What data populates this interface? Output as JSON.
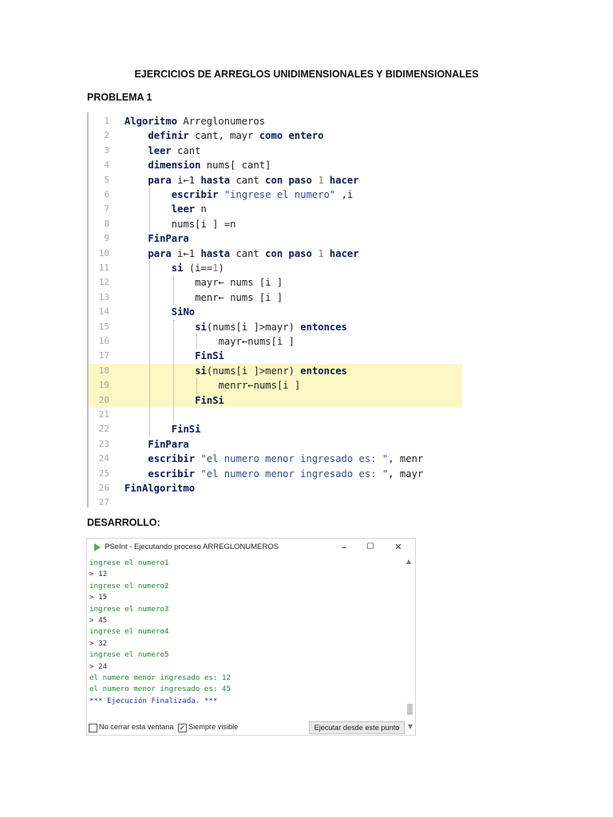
{
  "document": {
    "title": "EJERCICIOS DE ARREGLOS UNIDIMENSIONALES Y BIDIMENSIONALES",
    "problem_heading": "PROBLEMA 1",
    "development_heading": "DESARROLLO:"
  },
  "code": {
    "lines": [
      {
        "n": "1",
        "indent": 0,
        "tokens": [
          {
            "t": "Algoritmo",
            "c": "kw"
          },
          {
            "t": " Arreglonumeros"
          }
        ]
      },
      {
        "n": "2",
        "indent": 1,
        "tokens": [
          {
            "t": "definir",
            "c": "kw"
          },
          {
            "t": " cant, mayr "
          },
          {
            "t": "como",
            "c": "kw"
          },
          {
            "t": " "
          },
          {
            "t": "entero",
            "c": "kw"
          }
        ]
      },
      {
        "n": "3",
        "indent": 1,
        "tokens": [
          {
            "t": "leer",
            "c": "kw"
          },
          {
            "t": " cant"
          }
        ]
      },
      {
        "n": "4",
        "indent": 1,
        "tokens": [
          {
            "t": "dimension",
            "c": "kw"
          },
          {
            "t": " nums[ cant]"
          }
        ]
      },
      {
        "n": "5",
        "indent": 1,
        "tokens": [
          {
            "t": "para",
            "c": "kw"
          },
          {
            "t": " i←1 "
          },
          {
            "t": "hasta",
            "c": "kw"
          },
          {
            "t": " cant "
          },
          {
            "t": "con paso",
            "c": "kw"
          },
          {
            "t": " "
          },
          {
            "t": "1",
            "c": "num"
          },
          {
            "t": " "
          },
          {
            "t": "hacer",
            "c": "kw"
          }
        ]
      },
      {
        "n": "6",
        "indent": 2,
        "tokens": [
          {
            "t": "escribir",
            "c": "kw"
          },
          {
            "t": " "
          },
          {
            "t": "\"ingrese el numero\"",
            "c": "str"
          },
          {
            "t": " ,i"
          }
        ]
      },
      {
        "n": "7",
        "indent": 2,
        "tokens": [
          {
            "t": "leer",
            "c": "kw"
          },
          {
            "t": " n"
          }
        ]
      },
      {
        "n": "8",
        "indent": 2,
        "tokens": [
          {
            "t": "nums[i ] =n"
          }
        ]
      },
      {
        "n": "9",
        "indent": 1,
        "tokens": [
          {
            "t": "FinPara",
            "c": "kw"
          }
        ]
      },
      {
        "n": "10",
        "indent": 1,
        "tokens": [
          {
            "t": "para",
            "c": "kw"
          },
          {
            "t": " i←1 "
          },
          {
            "t": "hasta",
            "c": "kw"
          },
          {
            "t": " cant "
          },
          {
            "t": "con paso",
            "c": "kw"
          },
          {
            "t": " "
          },
          {
            "t": "1",
            "c": "num"
          },
          {
            "t": " "
          },
          {
            "t": "hacer",
            "c": "kw"
          }
        ]
      },
      {
        "n": "11",
        "indent": 2,
        "tokens": [
          {
            "t": "si",
            "c": "kw"
          },
          {
            "t": " (i=="
          },
          {
            "t": "1",
            "c": "num"
          },
          {
            "t": ")"
          }
        ]
      },
      {
        "n": "12",
        "indent": 3,
        "tokens": [
          {
            "t": "mayr← nums [i ]"
          }
        ]
      },
      {
        "n": "13",
        "indent": 3,
        "tokens": [
          {
            "t": "menr← nums [i ]"
          }
        ]
      },
      {
        "n": "14",
        "indent": 2,
        "tokens": [
          {
            "t": "SiNo",
            "c": "kw"
          }
        ]
      },
      {
        "n": "15",
        "indent": 3,
        "tokens": [
          {
            "t": "si",
            "c": "kw"
          },
          {
            "t": "(nums[i ]>mayr) "
          },
          {
            "t": "entonces",
            "c": "kw"
          }
        ]
      },
      {
        "n": "16",
        "indent": 4,
        "tokens": [
          {
            "t": "mayr←nums[i ]"
          }
        ]
      },
      {
        "n": "17",
        "indent": 3,
        "tokens": [
          {
            "t": "FinSi",
            "c": "kw"
          }
        ]
      },
      {
        "n": "18",
        "indent": 3,
        "hl": true,
        "tokens": [
          {
            "t": "si",
            "c": "kw"
          },
          {
            "t": "(nums[i ]>menr) "
          },
          {
            "t": "entonces",
            "c": "kw"
          }
        ]
      },
      {
        "n": "19",
        "indent": 4,
        "hl": true,
        "tokens": [
          {
            "t": "menrr←nums[i ]"
          }
        ]
      },
      {
        "n": "20",
        "indent": 3,
        "hl": true,
        "tokens": [
          {
            "t": "FinSi",
            "c": "kw"
          }
        ]
      },
      {
        "n": "21",
        "indent": 3,
        "tokens": []
      },
      {
        "n": "22",
        "indent": 2,
        "tokens": [
          {
            "t": "FinSi",
            "c": "kw"
          }
        ]
      },
      {
        "n": "23",
        "indent": 1,
        "tokens": [
          {
            "t": "FinPara",
            "c": "kw"
          }
        ]
      },
      {
        "n": "24",
        "indent": 1,
        "tokens": [
          {
            "t": "escribir",
            "c": "kw"
          },
          {
            "t": " "
          },
          {
            "t": "\"el numero menor ingresado es: \"",
            "c": "str"
          },
          {
            "t": ", menr"
          }
        ]
      },
      {
        "n": "25",
        "indent": 1,
        "tokens": [
          {
            "t": "escribir",
            "c": "kw"
          },
          {
            "t": " "
          },
          {
            "t": "\"el numero menor ingresado es: \"",
            "c": "str"
          },
          {
            "t": ", mayr"
          }
        ]
      },
      {
        "n": "26",
        "indent": 0,
        "tokens": [
          {
            "t": "FinAlgoritmo",
            "c": "kw"
          }
        ]
      },
      {
        "n": "27",
        "indent": 0,
        "tokens": []
      }
    ]
  },
  "console": {
    "window_title": "PSeInt - Ejecutando proceso ARREGLONUMEROS",
    "buttons": {
      "minimize": "–",
      "maximize": "☐",
      "close": "✕"
    },
    "output": [
      {
        "text": "ingrese el numero1",
        "kind": "prompt"
      },
      {
        "text": "> 12",
        "kind": "input"
      },
      {
        "text": "ingrese el numero2",
        "kind": "prompt"
      },
      {
        "text": "> 15",
        "kind": "input"
      },
      {
        "text": "ingrese el numero3",
        "kind": "prompt"
      },
      {
        "text": "> 45",
        "kind": "input"
      },
      {
        "text": "ingrese el numero4",
        "kind": "prompt"
      },
      {
        "text": "> 32",
        "kind": "input"
      },
      {
        "text": "ingrese el numero5",
        "kind": "prompt"
      },
      {
        "text": "> 24",
        "kind": "input"
      },
      {
        "text": "el numero menor ingresado es: 12",
        "kind": "prompt"
      },
      {
        "text": "el numero menor ingresado es: 45",
        "kind": "prompt"
      },
      {
        "text": "*** Ejecución Finalizada. ***",
        "kind": "status"
      }
    ],
    "colors": {
      "prompt": "#1e8a2e",
      "input": "#2b2b2b",
      "status": "#1a3aa8"
    },
    "footer": {
      "no_close_label": "No cerrar esta ventana",
      "no_close_checked": false,
      "always_visible_label": "Siempre visible",
      "always_visible_checked": true,
      "run_button_label": "Ejecutar desde este punto"
    }
  }
}
